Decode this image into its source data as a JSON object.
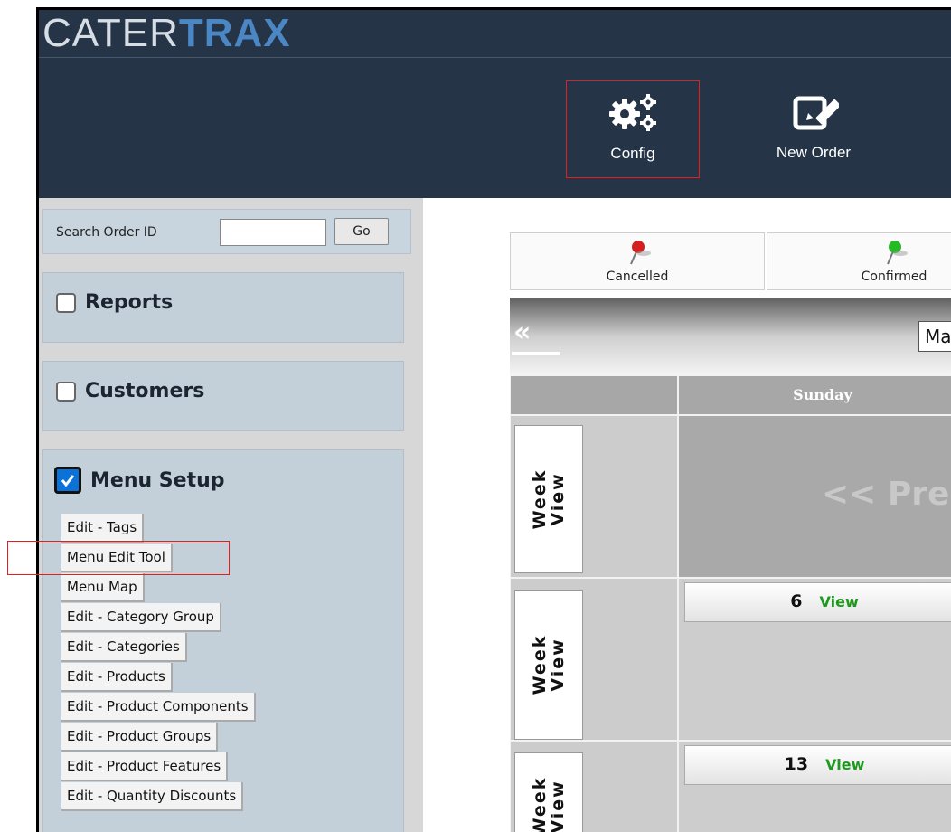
{
  "header": {
    "logo_part1": "CATER",
    "logo_part2": "TRAX",
    "nav": [
      {
        "label": "Config",
        "icon": "gears-icon"
      },
      {
        "label": "New Order",
        "icon": "edit-icon"
      }
    ]
  },
  "sidebar": {
    "search": {
      "label": "Search Order ID",
      "value": "",
      "button": "Go"
    },
    "sections": [
      {
        "label": "Reports",
        "checked": false
      },
      {
        "label": "Customers",
        "checked": false
      },
      {
        "label": "Menu Setup",
        "checked": true
      }
    ],
    "menu_setup_items": [
      "Edit - Tags",
      "Menu Edit Tool",
      "Menu Map",
      "Edit - Category Group",
      "Edit - Categories",
      "Edit - Products",
      "Edit - Product Components",
      "Edit - Product Groups",
      "Edit - Product Features",
      "Edit - Quantity Discounts"
    ]
  },
  "calendar": {
    "legend": [
      {
        "label": "Cancelled",
        "color": "#d42020"
      },
      {
        "label": "Confirmed",
        "color": "#28b828"
      }
    ],
    "prev_symbol": "«",
    "month_partial": "Ma",
    "weekday": "Sunday",
    "week_label": "Week\nView",
    "prev_text": "<< Pre",
    "days": [
      {
        "num": "6",
        "view": "View"
      },
      {
        "num": "13",
        "view": "View"
      }
    ]
  },
  "colors": {
    "header_bg": "#253447",
    "sidebar_section": "#c3d0da",
    "highlight": "#e02020",
    "view_link": "#1d9a1d"
  }
}
